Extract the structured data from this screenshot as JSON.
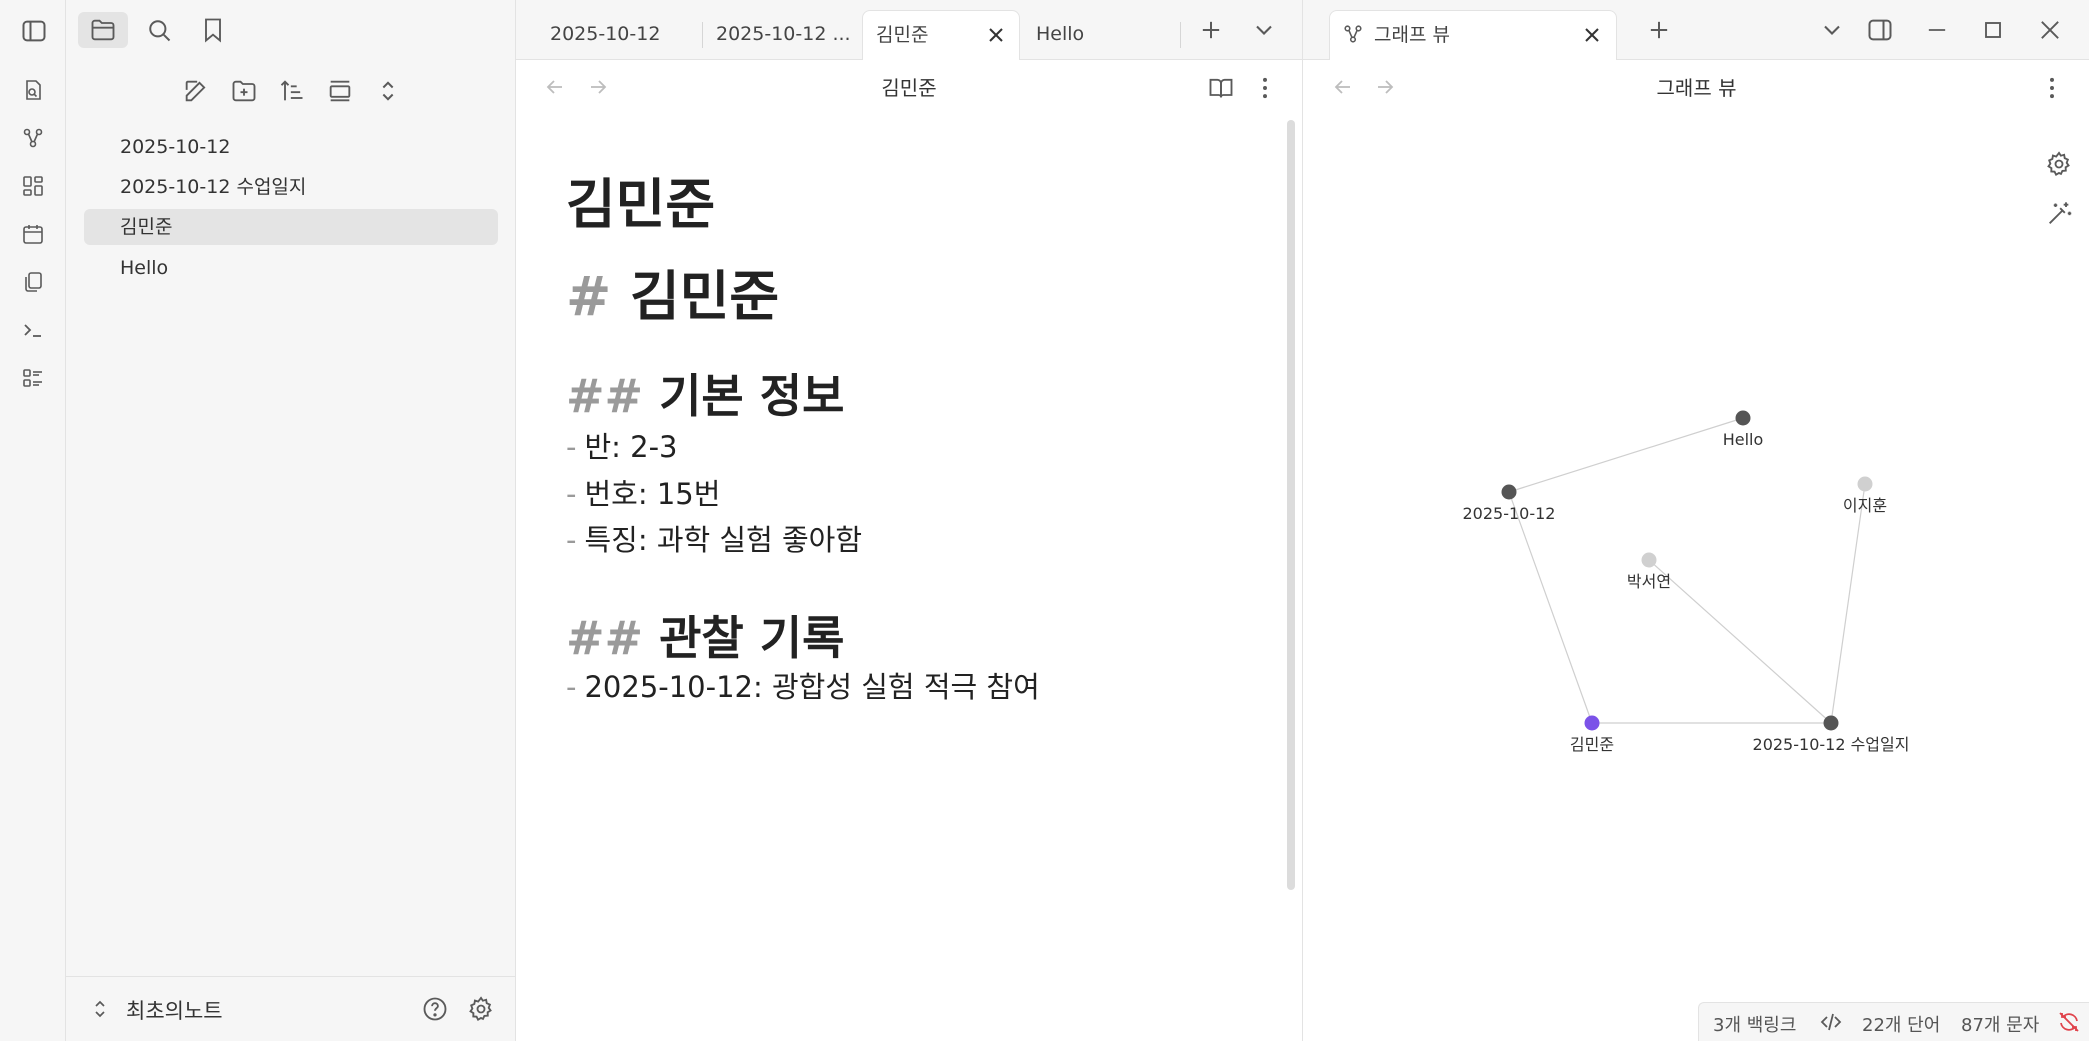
{
  "ribbon": {
    "icons": [
      "open-switcher-icon",
      "graph-view-icon",
      "canvas-icon",
      "daily-note-icon",
      "templates-icon",
      "command-palette-icon",
      "bases-icon"
    ]
  },
  "sidebar": {
    "files": [
      {
        "label": "2025-10-12",
        "active": false
      },
      {
        "label": "2025-10-12 수업일지",
        "active": false
      },
      {
        "label": "김민준",
        "active": true
      },
      {
        "label": "Hello",
        "active": false
      }
    ],
    "vault_name": "최초의노트"
  },
  "left_pane": {
    "tabs": [
      {
        "label": "2025-10-12",
        "active": false
      },
      {
        "label": "2025-10-12 ...",
        "active": false
      },
      {
        "label": "김민준",
        "active": true
      },
      {
        "label": "Hello",
        "active": false
      }
    ],
    "note_title": "김민준",
    "content": {
      "inline_title": "김민준",
      "h1_hash": "#",
      "h1": "김민준",
      "h2a_hash": "##",
      "h2a": "기본 정보",
      "list_a": [
        "반: 2-3",
        "번호: 15번",
        "특징: 과학 실험 좋아함"
      ],
      "h2b_hash": "##",
      "h2b": "관찰 기록",
      "list_b": [
        "2025-10-12: 광합성 실험 적극 참여"
      ],
      "bullet": "-"
    }
  },
  "right_pane": {
    "tab_label": "그래프 뷰",
    "view_title": "그래프 뷰",
    "graph": {
      "nodes": [
        {
          "id": "hello",
          "label": "Hello",
          "state": "resolved"
        },
        {
          "id": "d1012",
          "label": "2025-10-12",
          "state": "resolved"
        },
        {
          "id": "leejihun",
          "label": "이지훈",
          "state": "unresolved"
        },
        {
          "id": "parkseoyeon",
          "label": "박서연",
          "state": "unresolved"
        },
        {
          "id": "kimminjun",
          "label": "김민준",
          "state": "active"
        },
        {
          "id": "log",
          "label": "2025-10-12 수업일지",
          "state": "resolved"
        }
      ],
      "edges": [
        [
          "d1012",
          "hello"
        ],
        [
          "d1012",
          "kimminjun"
        ],
        [
          "kimminjun",
          "log"
        ],
        [
          "parkseoyeon",
          "log"
        ],
        [
          "leejihun",
          "log"
        ]
      ],
      "colors": {
        "resolved": "#555555",
        "unresolved": "#d0d0d0",
        "active": "#7b52e8",
        "edge": "#cfcfcf"
      }
    }
  },
  "status_bar": {
    "backlinks": "3개 백링크",
    "words": "22개 단어",
    "chars": "87개 문자"
  }
}
